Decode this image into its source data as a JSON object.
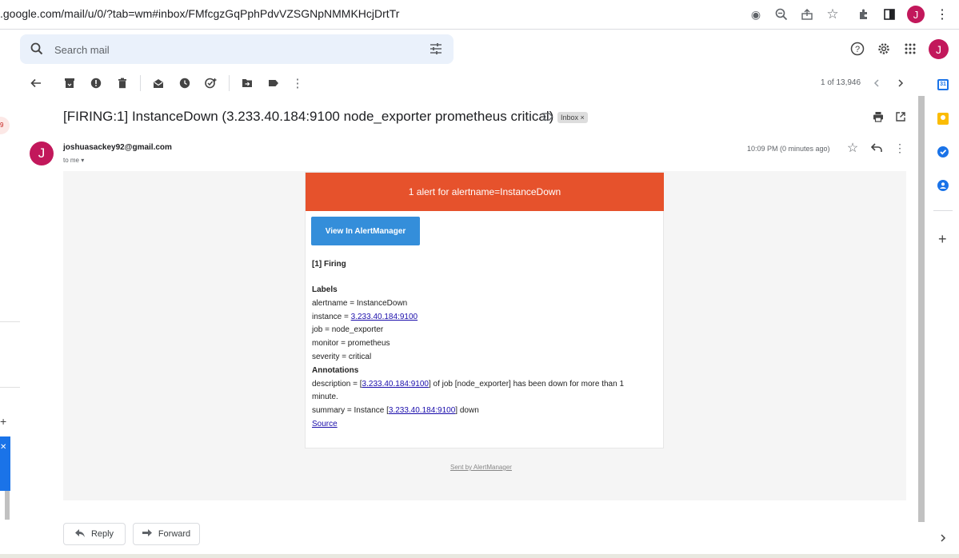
{
  "browser": {
    "url": ".google.com/mail/u/0/?tab=wm#inbox/FMfcgzGqPphPdvVZSGNpNMMKHcjDrtTr",
    "profile_initial": "J"
  },
  "search": {
    "placeholder": "Search mail"
  },
  "header": {
    "account_initial": "J"
  },
  "toolbar": {
    "page_count": "1 of 13,946"
  },
  "message": {
    "subject": "[FIRING:1] InstanceDown (3.233.40.184:9100 node_exporter prometheus critical)",
    "label_chip": "Inbox",
    "sender_initial": "J",
    "sender": "joshuasackey92@gmail.com",
    "recipient": "to me",
    "timestamp": "10:09 PM (0 minutes ago)"
  },
  "alert": {
    "banner": "1 alert for alertname=InstanceDown",
    "button": "View In AlertManager",
    "firing": "[1] Firing",
    "labels_heading": "Labels",
    "alertname": "alertname = InstanceDown",
    "instance_prefix": "instance = ",
    "instance_link": "3.233.40.184:9100",
    "job": "job = node_exporter",
    "monitor": "monitor = prometheus",
    "severity": "severity = critical",
    "annotations_heading": "Annotations",
    "desc_prefix": "description = [",
    "desc_link": "3.233.40.184:9100",
    "desc_suffix": "] of job [node_exporter] has been down for more than 1",
    "desc_line2": "minute.",
    "summary_prefix": "summary = Instance [",
    "summary_link": "3.233.40.184:9100",
    "summary_suffix": "] down",
    "source": "Source",
    "sent_by": "Sent by AlertManager"
  },
  "actions": {
    "reply": "Reply",
    "forward": "Forward"
  },
  "colors": {
    "banner": "#e6522c",
    "button": "#348eda",
    "avatar": "#c2185b",
    "search_bg": "#eaf1fb"
  }
}
